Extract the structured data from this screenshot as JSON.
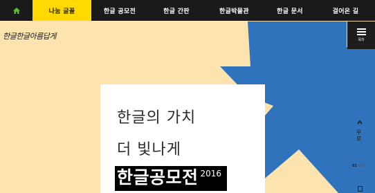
{
  "nav": {
    "home_icon": "home-icon",
    "items": [
      {
        "label": "나눔 글꼴",
        "active": true
      },
      {
        "label": "한글 공모전",
        "active": false
      },
      {
        "label": "한글 간판",
        "active": false
      },
      {
        "label": "한글박물관",
        "active": false
      },
      {
        "label": "한글 문서",
        "active": false
      },
      {
        "label": "걸어온 길",
        "active": false
      }
    ]
  },
  "logo": "한글한글아름답게",
  "menu": {
    "label": "목차",
    "icon": "hamburger-icon"
  },
  "hero": {
    "line1": "한글의 가치",
    "line2": "더 빛나게",
    "title": "한글공모전",
    "year": "2016"
  },
  "side": {
    "label": "우로",
    "pager_current": "01",
    "pager_total": "06"
  },
  "colors": {
    "background": "#fde3ae",
    "accent_yellow": "#ffd900",
    "shape_blue": "#2f73bd",
    "nav_dark": "#1a1a1a",
    "home_icon_green": "#5fbf2a"
  }
}
